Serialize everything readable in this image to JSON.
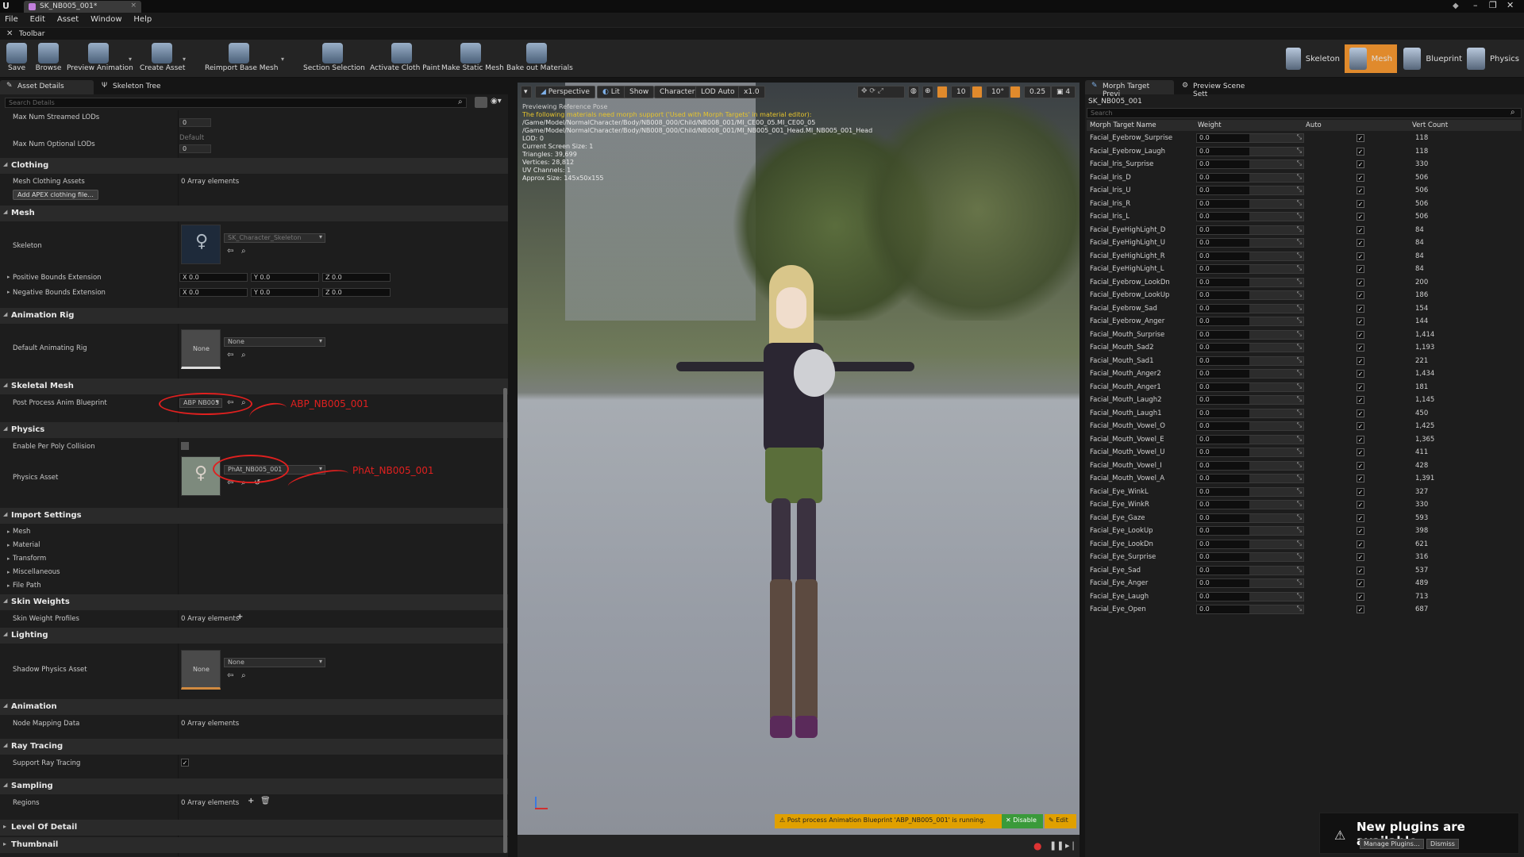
{
  "window": {
    "tab_title": "SK_NB005_001*"
  },
  "menu": [
    "File",
    "Edit",
    "Asset",
    "Window",
    "Help"
  ],
  "toolbar_tab": "Toolbar",
  "toolbar": [
    {
      "label": "Save",
      "icon": "save-icon"
    },
    {
      "label": "Browse",
      "icon": "browse-icon"
    },
    {
      "label": "Preview Animation",
      "icon": "preview-animation-icon"
    },
    {
      "label": "Create Asset",
      "icon": "create-asset-icon"
    },
    {
      "label": "Reimport Base Mesh",
      "icon": "reimport-icon"
    },
    {
      "label": "Section Selection",
      "icon": "section-selection-icon"
    },
    {
      "label": "Activate Cloth Paint",
      "icon": "cloth-paint-icon"
    },
    {
      "label": "Make Static Mesh",
      "icon": "static-mesh-icon"
    },
    {
      "label": "Bake out Materials",
      "icon": "bake-materials-icon"
    }
  ],
  "modes": [
    "Skeleton",
    "Mesh",
    "Blueprint",
    "Physics"
  ],
  "left_panel": {
    "tabs": [
      "Asset Details",
      "Skeleton Tree"
    ],
    "search_placeholder": "Search Details",
    "max_streamed_lods": "Max Num Streamed LODs",
    "max_optional_lods": "Max Num Optional LODs",
    "default_label": "Default",
    "zero": "0",
    "categories": {
      "clothing": "Clothing",
      "mesh": "Mesh",
      "animation_rig": "Animation Rig",
      "skeletal_mesh": "Skeletal Mesh",
      "physics": "Physics",
      "import_settings": "Import Settings",
      "skin_weights": "Skin Weights",
      "lighting": "Lighting",
      "animation": "Animation",
      "ray_tracing": "Ray Tracing",
      "sampling": "Sampling",
      "lod": "Level Of Detail",
      "thumbnail": "Thumbnail"
    },
    "mesh_clothing_assets": "Mesh Clothing Assets",
    "array_elements": "0 Array elements",
    "add_apex": "Add APEX clothing file...",
    "skeleton": "Skeleton",
    "skeleton_value": "SK_Character_Skeleton",
    "pos_bounds": "Positive Bounds Extension",
    "neg_bounds": "Negative Bounds Extension",
    "vec_x": "X  0.0",
    "vec_y": "Y  0.0",
    "vec_z": "Z  0.0",
    "default_anim_rig": "Default Animating Rig",
    "none": "None",
    "post_process_bp": "Post Process Anim Blueprint",
    "post_process_value": "ABP NB005",
    "enable_per_poly": "Enable Per Poly Collision",
    "physics_asset": "Physics Asset",
    "physics_asset_value": "PhAt_NB005_001",
    "import_items": [
      "Mesh",
      "Material",
      "Transform",
      "Miscellaneous",
      "File Path"
    ],
    "skin_weight_profiles": "Skin Weight Profiles",
    "shadow_physics_asset": "Shadow Physics Asset",
    "node_mapping": "Node Mapping Data",
    "support_ray_tracing": "Support Ray Tracing",
    "regions": "Regions",
    "annot_abp": "ABP_NB005_001",
    "annot_phat": "PhAt_NB005_001"
  },
  "viewport": {
    "buttons": [
      "Perspective",
      "Lit",
      "Show",
      "Character",
      "LOD Auto",
      "x1.0"
    ],
    "right_values": [
      "10",
      "10°",
      "0.25",
      "4"
    ],
    "info": [
      "Previewing Reference Pose",
      "The following materials need morph support ('Used with Morph Targets' in material editor):",
      "/Game/Model/NormalCharacter/Body/NB008_000/Child/NB008_001/MI_CE00_05.MI_CE00_05",
      "/Game/Model/NormalCharacter/Body/NB008_000/Child/NB008_001/MI_NB005_001_Head.MI_NB005_001_Head",
      "LOD: 0",
      "Current Screen Size: 1",
      "Triangles: 39,699",
      "Vertices: 28,812",
      "UV Channels: 1",
      "Approx Size: 145x50x155"
    ],
    "warning": "Post process Animation Blueprint 'ABP_NB005_001' is running.",
    "disable": "Disable",
    "edit": "Edit"
  },
  "right_panel": {
    "tabs": [
      "Morph Target Previ",
      "Preview Scene Sett"
    ],
    "asset_name": "SK_NB005_001",
    "search_placeholder": "Search",
    "headers": [
      "Morph Target Name",
      "Weight",
      "Auto",
      "Vert Count"
    ],
    "rows": [
      {
        "name": "Facial_Eyebrow_Surprise",
        "weight": "0.0",
        "vc": "118"
      },
      {
        "name": "Facial_Eyebrow_Laugh",
        "weight": "0.0",
        "vc": "118"
      },
      {
        "name": "Facial_Iris_Surprise",
        "weight": "0.0",
        "vc": "330"
      },
      {
        "name": "Facial_Iris_D",
        "weight": "0.0",
        "vc": "506"
      },
      {
        "name": "Facial_Iris_U",
        "weight": "0.0",
        "vc": "506"
      },
      {
        "name": "Facial_Iris_R",
        "weight": "0.0",
        "vc": "506"
      },
      {
        "name": "Facial_Iris_L",
        "weight": "0.0",
        "vc": "506"
      },
      {
        "name": "Facial_EyeHighLight_D",
        "weight": "0.0",
        "vc": "84"
      },
      {
        "name": "Facial_EyeHighLight_U",
        "weight": "0.0",
        "vc": "84"
      },
      {
        "name": "Facial_EyeHighLight_R",
        "weight": "0.0",
        "vc": "84"
      },
      {
        "name": "Facial_EyeHighLight_L",
        "weight": "0.0",
        "vc": "84"
      },
      {
        "name": "Facial_Eyebrow_LookDn",
        "weight": "0.0",
        "vc": "200"
      },
      {
        "name": "Facial_Eyebrow_LookUp",
        "weight": "0.0",
        "vc": "186"
      },
      {
        "name": "Facial_Eyebrow_Sad",
        "weight": "0.0",
        "vc": "154"
      },
      {
        "name": "Facial_Eyebrow_Anger",
        "weight": "0.0",
        "vc": "144"
      },
      {
        "name": "Facial_Mouth_Surprise",
        "weight": "0.0",
        "vc": "1,414"
      },
      {
        "name": "Facial_Mouth_Sad2",
        "weight": "0.0",
        "vc": "1,193"
      },
      {
        "name": "Facial_Mouth_Sad1",
        "weight": "0.0",
        "vc": "221"
      },
      {
        "name": "Facial_Mouth_Anger2",
        "weight": "0.0",
        "vc": "1,434"
      },
      {
        "name": "Facial_Mouth_Anger1",
        "weight": "0.0",
        "vc": "181"
      },
      {
        "name": "Facial_Mouth_Laugh2",
        "weight": "0.0",
        "vc": "1,145"
      },
      {
        "name": "Facial_Mouth_Laugh1",
        "weight": "0.0",
        "vc": "450"
      },
      {
        "name": "Facial_Mouth_Vowel_O",
        "weight": "0.0",
        "vc": "1,425"
      },
      {
        "name": "Facial_Mouth_Vowel_E",
        "weight": "0.0",
        "vc": "1,365"
      },
      {
        "name": "Facial_Mouth_Vowel_U",
        "weight": "0.0",
        "vc": "411"
      },
      {
        "name": "Facial_Mouth_Vowel_I",
        "weight": "0.0",
        "vc": "428"
      },
      {
        "name": "Facial_Mouth_Vowel_A",
        "weight": "0.0",
        "vc": "1,391"
      },
      {
        "name": "Facial_Eye_WinkL",
        "weight": "0.0",
        "vc": "327"
      },
      {
        "name": "Facial_Eye_WinkR",
        "weight": "0.0",
        "vc": "330"
      },
      {
        "name": "Facial_Eye_Gaze",
        "weight": "0.0",
        "vc": "593"
      },
      {
        "name": "Facial_Eye_LookUp",
        "weight": "0.0",
        "vc": "398"
      },
      {
        "name": "Facial_Eye_LookDn",
        "weight": "0.0",
        "vc": "621"
      },
      {
        "name": "Facial_Eye_Surprise",
        "weight": "0.0",
        "vc": "316"
      },
      {
        "name": "Facial_Eye_Sad",
        "weight": "0.0",
        "vc": "537"
      },
      {
        "name": "Facial_Eye_Anger",
        "weight": "0.0",
        "vc": "489"
      },
      {
        "name": "Facial_Eye_Laugh",
        "weight": "0.0",
        "vc": "713"
      },
      {
        "name": "Facial_Eye_Open",
        "weight": "0.0",
        "vc": "687"
      }
    ]
  },
  "notification": {
    "title": "New plugins are available",
    "manage": "Manage Plugins...",
    "dismiss": "Dismiss"
  },
  "colors": {
    "accent": "#e0a000",
    "mesh_mode": "#e08a2c",
    "annotation": "#e0201f",
    "warning_text": "#e6c42c"
  }
}
